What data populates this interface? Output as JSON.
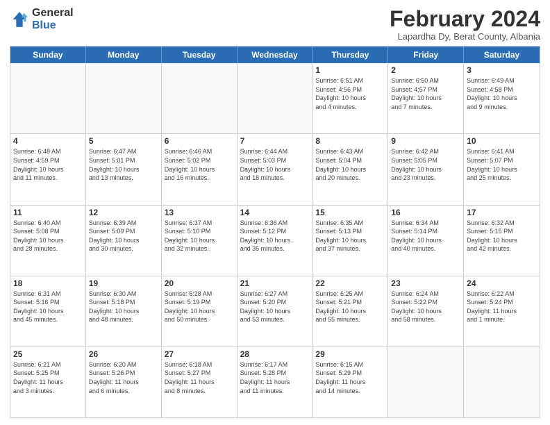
{
  "logo": {
    "general": "General",
    "blue": "Blue"
  },
  "title": "February 2024",
  "subtitle": "Lapardha Dy, Berat County, Albania",
  "days_of_week": [
    "Sunday",
    "Monday",
    "Tuesday",
    "Wednesday",
    "Thursday",
    "Friday",
    "Saturday"
  ],
  "weeks": [
    [
      {
        "day": "",
        "info": ""
      },
      {
        "day": "",
        "info": ""
      },
      {
        "day": "",
        "info": ""
      },
      {
        "day": "",
        "info": ""
      },
      {
        "day": "1",
        "info": "Sunrise: 6:51 AM\nSunset: 4:56 PM\nDaylight: 10 hours\nand 4 minutes."
      },
      {
        "day": "2",
        "info": "Sunrise: 6:50 AM\nSunset: 4:57 PM\nDaylight: 10 hours\nand 7 minutes."
      },
      {
        "day": "3",
        "info": "Sunrise: 6:49 AM\nSunset: 4:58 PM\nDaylight: 10 hours\nand 9 minutes."
      }
    ],
    [
      {
        "day": "4",
        "info": "Sunrise: 6:48 AM\nSunset: 4:59 PM\nDaylight: 10 hours\nand 11 minutes."
      },
      {
        "day": "5",
        "info": "Sunrise: 6:47 AM\nSunset: 5:01 PM\nDaylight: 10 hours\nand 13 minutes."
      },
      {
        "day": "6",
        "info": "Sunrise: 6:46 AM\nSunset: 5:02 PM\nDaylight: 10 hours\nand 16 minutes."
      },
      {
        "day": "7",
        "info": "Sunrise: 6:44 AM\nSunset: 5:03 PM\nDaylight: 10 hours\nand 18 minutes."
      },
      {
        "day": "8",
        "info": "Sunrise: 6:43 AM\nSunset: 5:04 PM\nDaylight: 10 hours\nand 20 minutes."
      },
      {
        "day": "9",
        "info": "Sunrise: 6:42 AM\nSunset: 5:05 PM\nDaylight: 10 hours\nand 23 minutes."
      },
      {
        "day": "10",
        "info": "Sunrise: 6:41 AM\nSunset: 5:07 PM\nDaylight: 10 hours\nand 25 minutes."
      }
    ],
    [
      {
        "day": "11",
        "info": "Sunrise: 6:40 AM\nSunset: 5:08 PM\nDaylight: 10 hours\nand 28 minutes."
      },
      {
        "day": "12",
        "info": "Sunrise: 6:39 AM\nSunset: 5:09 PM\nDaylight: 10 hours\nand 30 minutes."
      },
      {
        "day": "13",
        "info": "Sunrise: 6:37 AM\nSunset: 5:10 PM\nDaylight: 10 hours\nand 32 minutes."
      },
      {
        "day": "14",
        "info": "Sunrise: 6:36 AM\nSunset: 5:12 PM\nDaylight: 10 hours\nand 35 minutes."
      },
      {
        "day": "15",
        "info": "Sunrise: 6:35 AM\nSunset: 5:13 PM\nDaylight: 10 hours\nand 37 minutes."
      },
      {
        "day": "16",
        "info": "Sunrise: 6:34 AM\nSunset: 5:14 PM\nDaylight: 10 hours\nand 40 minutes."
      },
      {
        "day": "17",
        "info": "Sunrise: 6:32 AM\nSunset: 5:15 PM\nDaylight: 10 hours\nand 42 minutes."
      }
    ],
    [
      {
        "day": "18",
        "info": "Sunrise: 6:31 AM\nSunset: 5:16 PM\nDaylight: 10 hours\nand 45 minutes."
      },
      {
        "day": "19",
        "info": "Sunrise: 6:30 AM\nSunset: 5:18 PM\nDaylight: 10 hours\nand 48 minutes."
      },
      {
        "day": "20",
        "info": "Sunrise: 6:28 AM\nSunset: 5:19 PM\nDaylight: 10 hours\nand 50 minutes."
      },
      {
        "day": "21",
        "info": "Sunrise: 6:27 AM\nSunset: 5:20 PM\nDaylight: 10 hours\nand 53 minutes."
      },
      {
        "day": "22",
        "info": "Sunrise: 6:25 AM\nSunset: 5:21 PM\nDaylight: 10 hours\nand 55 minutes."
      },
      {
        "day": "23",
        "info": "Sunrise: 6:24 AM\nSunset: 5:22 PM\nDaylight: 10 hours\nand 58 minutes."
      },
      {
        "day": "24",
        "info": "Sunrise: 6:22 AM\nSunset: 5:24 PM\nDaylight: 11 hours\nand 1 minute."
      }
    ],
    [
      {
        "day": "25",
        "info": "Sunrise: 6:21 AM\nSunset: 5:25 PM\nDaylight: 11 hours\nand 3 minutes."
      },
      {
        "day": "26",
        "info": "Sunrise: 6:20 AM\nSunset: 5:26 PM\nDaylight: 11 hours\nand 6 minutes."
      },
      {
        "day": "27",
        "info": "Sunrise: 6:18 AM\nSunset: 5:27 PM\nDaylight: 11 hours\nand 8 minutes."
      },
      {
        "day": "28",
        "info": "Sunrise: 6:17 AM\nSunset: 5:28 PM\nDaylight: 11 hours\nand 11 minutes."
      },
      {
        "day": "29",
        "info": "Sunrise: 6:15 AM\nSunset: 5:29 PM\nDaylight: 11 hours\nand 14 minutes."
      },
      {
        "day": "",
        "info": ""
      },
      {
        "day": "",
        "info": ""
      }
    ]
  ]
}
